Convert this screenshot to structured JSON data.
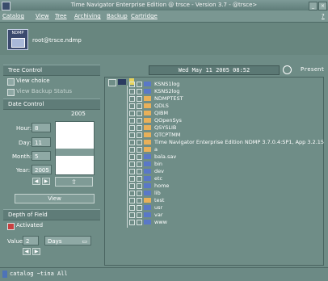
{
  "window": {
    "title": "Time Navigator Enterprise Edition @ trsce - Version 3.7 - @trsce>"
  },
  "menu": {
    "items": [
      "Catalog",
      "View",
      "Tree",
      "Archiving",
      "Backup",
      "Cartridge"
    ],
    "help": "?"
  },
  "header": {
    "user": "root@trsce.ndmp",
    "icon_label": "NDMP"
  },
  "left": {
    "tree_control": {
      "title": "Tree Control",
      "view_choice": "View choice",
      "view_backup_status": "View Backup Status"
    },
    "date_control": {
      "title": "Date Control",
      "year_header": "2005",
      "hour_label": "Hour:",
      "hour": "8",
      "day_label": "Day:",
      "day": "11",
      "month_label": "Month:",
      "month": "5",
      "year_label": "Year:",
      "year": "2005",
      "view": "View"
    },
    "depth": {
      "title": "Depth of Field",
      "activated": "Activated",
      "value_label": "Value:",
      "value": "2",
      "unit": "Days"
    }
  },
  "right": {
    "date": "Wed May 11 2005 08:52",
    "present": "Present",
    "tree": [
      "KSNS1log",
      "KSNS2log",
      "NDMPTEST",
      "QDLS",
      "QIBM",
      "QOpenSys",
      "QSYSLIB",
      "QTCPTMM",
      "Time Navigator Enterprise Edition NDMP 3.7.0.4:SP1, App 3.2.15",
      "a",
      "bala.sav",
      "bin",
      "dev",
      "etc",
      "home",
      "lib",
      "test",
      "usr",
      "var",
      "www"
    ]
  },
  "status": {
    "text": "catalog ~tina  All"
  },
  "colors": {
    "folder": "#e8b05a",
    "blue_folder": "#5a78c8",
    "background": "#6e8c86"
  }
}
